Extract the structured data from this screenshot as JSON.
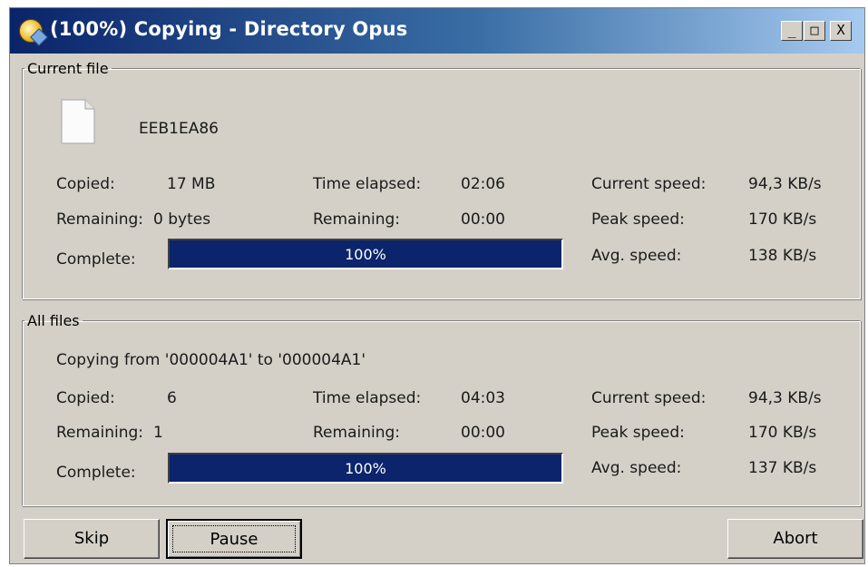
{
  "window": {
    "title": "(100%) Copying - Directory Opus",
    "controls": {
      "minimize": "_",
      "maximize": "□",
      "close": "X"
    }
  },
  "current_file": {
    "legend": "Current file",
    "file_name": "EEB1EA86",
    "copied_label": "Copied:",
    "copied_value": "17 MB",
    "remaining_label": "Remaining:",
    "remaining_value": "0 bytes",
    "time_elapsed_label": "Time elapsed:",
    "time_elapsed_value": "02:06",
    "time_remaining_label": "Remaining:",
    "time_remaining_value": "00:00",
    "current_speed_label": "Current speed:",
    "current_speed_value": "94,3 KB/s",
    "peak_speed_label": "Peak speed:",
    "peak_speed_value": "170 KB/s",
    "avg_speed_label": "Avg. speed:",
    "avg_speed_value": "138 KB/s",
    "complete_label": "Complete:",
    "progress_text": "100%",
    "progress_fraction": 1.0
  },
  "all_files": {
    "legend": "All files",
    "copying_text": "Copying from '000004A1' to '000004A1'",
    "copied_label": "Copied:",
    "copied_value": "6",
    "remaining_label": "Remaining:",
    "remaining_value": "1",
    "time_elapsed_label": "Time elapsed:",
    "time_elapsed_value": "04:03",
    "time_remaining_label": "Remaining:",
    "time_remaining_value": "00:00",
    "current_speed_label": "Current speed:",
    "current_speed_value": "94,3 KB/s",
    "peak_speed_label": "Peak speed:",
    "peak_speed_value": "170 KB/s",
    "avg_speed_label": "Avg. speed:",
    "avg_speed_value": "137 KB/s",
    "complete_label": "Complete:",
    "progress_text": "100%",
    "progress_fraction": 1.0
  },
  "buttons": {
    "skip": "Skip",
    "pause": "Pause",
    "abort": "Abort"
  },
  "colors": {
    "progress_fill": "#0b246b",
    "title_bar_start": "#0a246a",
    "dialog_face": "#d4d0c8"
  }
}
